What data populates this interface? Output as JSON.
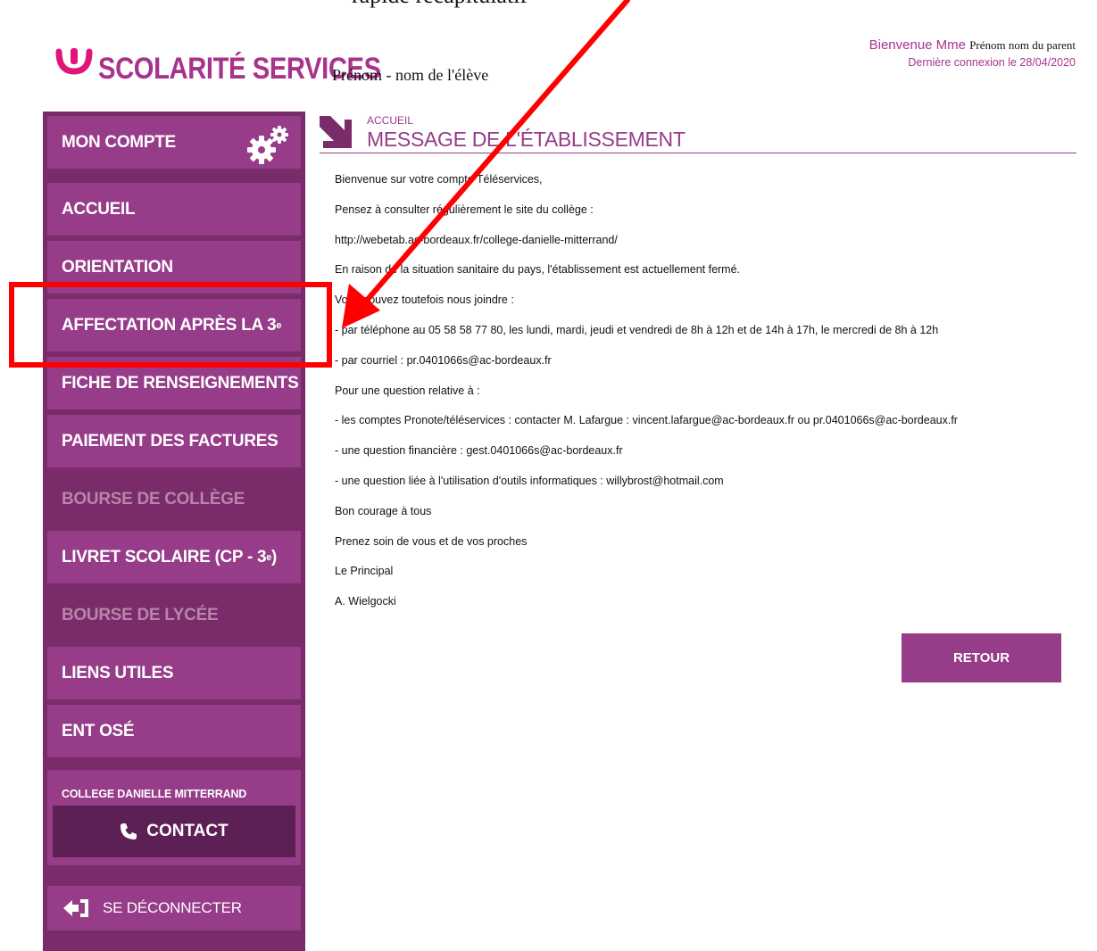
{
  "top_caption": "rapide récapitulatif",
  "header": {
    "logo_text": "SCOLARITÉ SERVICES",
    "student_name": "Prénom - nom de l'élève",
    "welcome_prefix": "Bienvenue Mme",
    "parent_name": "Prénom nom du parent",
    "last_login": "Dernière connexion le 28/04/2020"
  },
  "sidebar": {
    "items": [
      {
        "label": "MON COMPTE"
      },
      {
        "label": "ACCUEIL"
      },
      {
        "label": "ORIENTATION"
      },
      {
        "label": "AFFECTATION APRÈS LA 3",
        "sup": "e"
      },
      {
        "label": "FICHE DE RENSEIGNEMENTS"
      },
      {
        "label": "PAIEMENT DES FACTURES"
      },
      {
        "label": "BOURSE DE COLLÈGE"
      },
      {
        "label": "LIVRET SCOLAIRE (CP - 3",
        "sup": "e",
        "after": ")"
      },
      {
        "label": "BOURSE DE LYCÉE"
      },
      {
        "label": "LIENS UTILES"
      },
      {
        "label": "ENT OSÉ"
      }
    ],
    "college_name": "COLLEGE DANIELLE MITTERRAND",
    "contact_label": "CONTACT",
    "logout_label": "SE DÉCONNECTER"
  },
  "main": {
    "breadcrumb": "ACCUEIL",
    "title": "MESSAGE DE L'ÉTABLISSEMENT",
    "message_lines": [
      "Bienvenue sur votre compte Téléservices,",
      "Pensez à consulter régulièrement le site du collège :",
      "http://webetab.ac-bordeaux.fr/college-danielle-mitterrand/",
      "En raison de la situation sanitaire du pays, l'établissement est actuellement fermé.",
      "Vous pouvez toutefois nous joindre :",
      "- par téléphone au 05 58 58 77 80, les lundi, mardi, jeudi et vendredi de 8h à 12h et de 14h à 17h, le mercredi de 8h à 12h",
      "- par courriel : pr.0401066s@ac-bordeaux.fr",
      "Pour une question relative à :",
      "- les comptes Pronote/téléservices : contacter M. Lafargue : vincent.lafargue@ac-bordeaux.fr ou pr.0401066s@ac-bordeaux.fr",
      "- une question financière : gest.0401066s@ac-bordeaux.fr",
      "- une question liée à l'utilisation d'outils informatiques : willybrost@hotmail.com",
      "Bon courage à tous",
      "Prenez soin de vous et de vos proches",
      "Le Principal",
      "A. Wielgocki"
    ],
    "retour_label": "RETOUR"
  },
  "colors": {
    "brand": "#963c89",
    "sidebar_bg": "#7a2b6a",
    "annotation": "#ff0000"
  }
}
